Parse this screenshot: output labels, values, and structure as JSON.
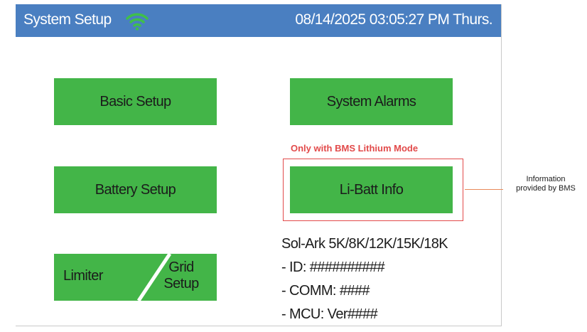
{
  "header": {
    "title": "System Setup",
    "wifi_icon": "wifi-icon",
    "datetime": "08/14/2025 03:05:27 PM Thurs."
  },
  "buttons": {
    "basic_setup": "Basic Setup",
    "system_alarms": "System Alarms",
    "battery_setup": "Battery Setup",
    "li_batt_info": "Li-Batt Info",
    "limiter": "Limiter",
    "grid_setup_line1": "Grid",
    "grid_setup_line2": "Setup"
  },
  "note": "Only with BMS Lithium Mode",
  "device_info": {
    "model": "Sol-Ark 5K/8K/12K/15K/18K",
    "id": "- ID: ##########",
    "comm": "- COMM: ####",
    "mcu": "- MCU: Ver####"
  },
  "annotation": {
    "line1": "Information",
    "line2": "provided by BMS"
  },
  "colors": {
    "header": "#4a7fc1",
    "button": "#43b548",
    "wifi": "#3fbf4a",
    "highlight": "#e24a4a"
  }
}
